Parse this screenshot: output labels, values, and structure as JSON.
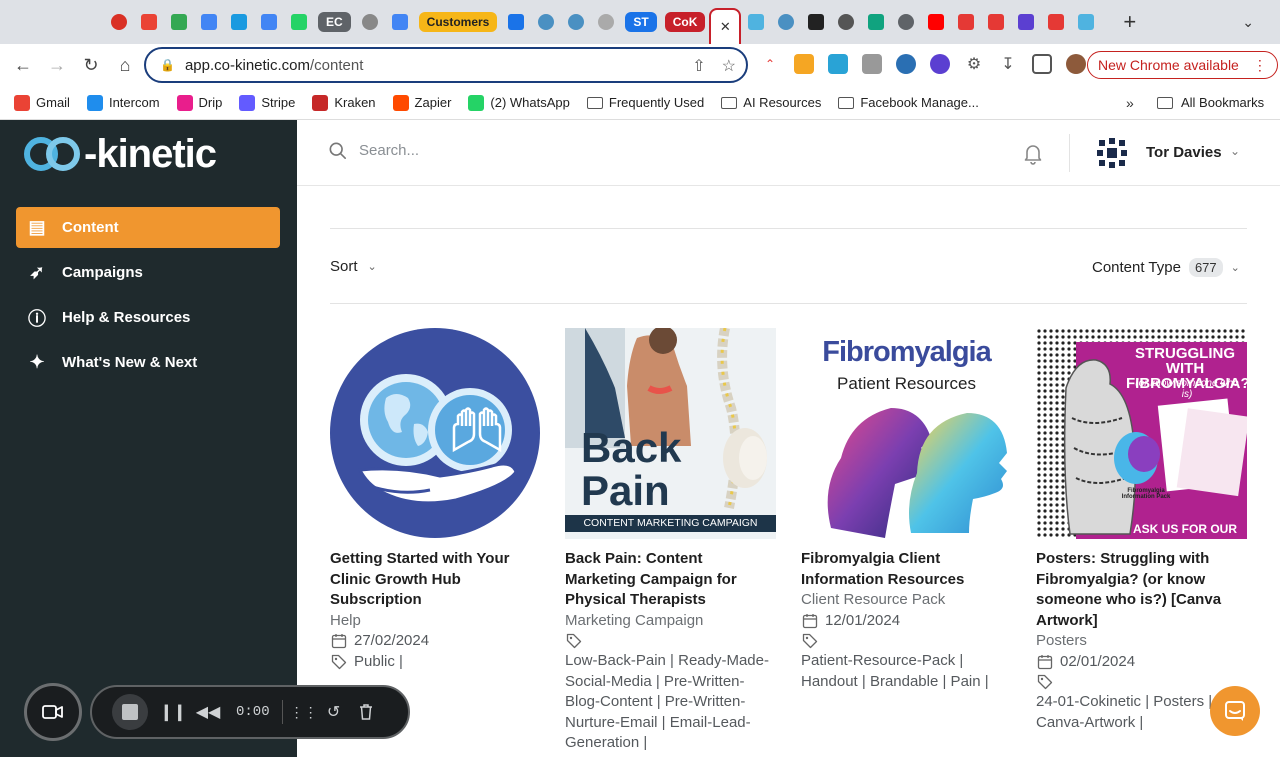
{
  "browser": {
    "tabs": [
      {
        "icon": "record-icon",
        "color": "#d93025"
      },
      {
        "icon": "gmail-icon",
        "color": "#ea4335"
      },
      {
        "icon": "drive-icon",
        "color": "#34a853"
      },
      {
        "icon": "docs-icon",
        "color": "#4285f4"
      },
      {
        "icon": "stripe-s-icon",
        "color": "#1a9ae0"
      },
      {
        "icon": "calendar-icon",
        "color": "#4285f4"
      },
      {
        "icon": "whatsapp-icon",
        "color": "#25d366"
      },
      {
        "label": "EC",
        "color": "#5f6368"
      },
      {
        "icon": "refresh-circle-icon",
        "color": "#888888"
      },
      {
        "icon": "drop-icon",
        "color": "#4285f4"
      },
      {
        "label": "Customers",
        "color": "#f6b618"
      },
      {
        "icon": "calendar-icon",
        "color": "#1a73e8"
      },
      {
        "icon": "circle-icon",
        "color": "#4a90c2"
      },
      {
        "icon": "circle-icon",
        "color": "#4a90c2"
      },
      {
        "icon": "circle-icon",
        "color": "#aaaaaa"
      },
      {
        "label": "ST",
        "color": "#1a73e8"
      },
      {
        "label": "CoK",
        "color": "#c7202a"
      },
      {
        "icon": "close-icon",
        "active": true
      },
      {
        "icon": "cokinetic-icon",
        "color": "#4fb3e0"
      },
      {
        "icon": "circle-icon",
        "color": "#4a90c2"
      },
      {
        "icon": "trello-icon",
        "color": "#222222"
      },
      {
        "icon": "globe-icon",
        "color": "#555555"
      },
      {
        "icon": "chatgpt-icon",
        "color": "#10a37f"
      },
      {
        "icon": "record-icon",
        "color": "#5f6368"
      },
      {
        "icon": "youtube-icon",
        "color": "#ff0000"
      },
      {
        "icon": "youtube-icon",
        "color": "#e53935"
      },
      {
        "icon": "asterisk-icon",
        "color": "#e53935"
      },
      {
        "icon": "sparkle-icon",
        "color": "#5b3fd1"
      },
      {
        "icon": "youtube-icon",
        "color": "#e53935"
      },
      {
        "icon": "cokinetic-icon",
        "color": "#4fb3e0"
      }
    ],
    "url_domain": "app.co-kinetic.com",
    "url_path": "/content",
    "update_label": "New Chrome available",
    "bookmarks": [
      {
        "label": "Gmail",
        "icon": "gmail-icon",
        "color": "#ea4335"
      },
      {
        "label": "Intercom",
        "icon": "intercom-icon",
        "color": "#1f8ded"
      },
      {
        "label": "Drip",
        "icon": "drip-icon",
        "color": "#e91e8c"
      },
      {
        "label": "Stripe",
        "icon": "stripe-icon",
        "color": "#635bff"
      },
      {
        "label": "Kraken",
        "icon": "kraken-icon",
        "color": "#c62828"
      },
      {
        "label": "Zapier",
        "icon": "zapier-icon",
        "color": "#ff4a00"
      },
      {
        "label": "(2) WhatsApp",
        "icon": "whatsapp-icon",
        "color": "#25d366"
      },
      {
        "label": "Frequently Used",
        "icon": "folder-icon"
      },
      {
        "label": "AI Resources",
        "icon": "folder-icon"
      },
      {
        "label": "Facebook Manage...",
        "icon": "folder-icon"
      }
    ],
    "all_bookmarks": "All Bookmarks"
  },
  "app": {
    "logo_word": "-kinetic",
    "nav": [
      {
        "label": "Content",
        "icon": "content-icon",
        "active": true
      },
      {
        "label": "Campaigns",
        "icon": "rocket-icon"
      },
      {
        "label": "Help & Resources",
        "icon": "info-icon"
      },
      {
        "label": "What's New & Next",
        "icon": "sparkle-icon"
      }
    ],
    "search_placeholder": "Search...",
    "user_name": "Tor Davies",
    "sort_label": "Sort",
    "content_type_label": "Content Type",
    "content_type_count": "677",
    "accent": "#f0962f",
    "sidebar_bg": "#1f2a2d"
  },
  "cards": [
    {
      "title": "Getting Started with Your Clinic Growth Hub Subscription",
      "category": "Help",
      "date": "27/02/2024",
      "tags": "Public |"
    },
    {
      "title": "Back Pain: Content Marketing Campaign for Physical Therapists",
      "category": "Marketing Campaign",
      "date": "",
      "tags": "Low-Back-Pain | Ready-Made-Social-Media | Pre-Written-Blog-Content | Pre-Written-Nurture-Email | Email-Lead-Generation |",
      "thumb_big": "Back Pain",
      "thumb_strip": "CONTENT MARKETING CAMPAIGN"
    },
    {
      "title": "Fibromyalgia Client Information Resources",
      "category": "Client Resource Pack",
      "date": "12/01/2024",
      "tags": "Patient-Resource-Pack | Handout | Brandable | Pain |",
      "thumb_title": "Fibromyalgia",
      "thumb_sub": "Patient Resources"
    },
    {
      "title": "Posters: Struggling with Fibromyalgia? (or know someone who is?) [Canva Artwork]",
      "category": "Posters",
      "date": "02/01/2024",
      "tags": "24-01-Cokinetic | Posters | Canva-Artwork |",
      "thumb_title": "STRUGGLING WITH FIBROMYALGIA?",
      "thumb_sub": "(or know someone who is)",
      "thumb_pack": "Fibromyalgia Information Pack",
      "thumb_cta": "ASK US FOR OUR"
    }
  ],
  "recorder": {
    "time": "0:00"
  }
}
